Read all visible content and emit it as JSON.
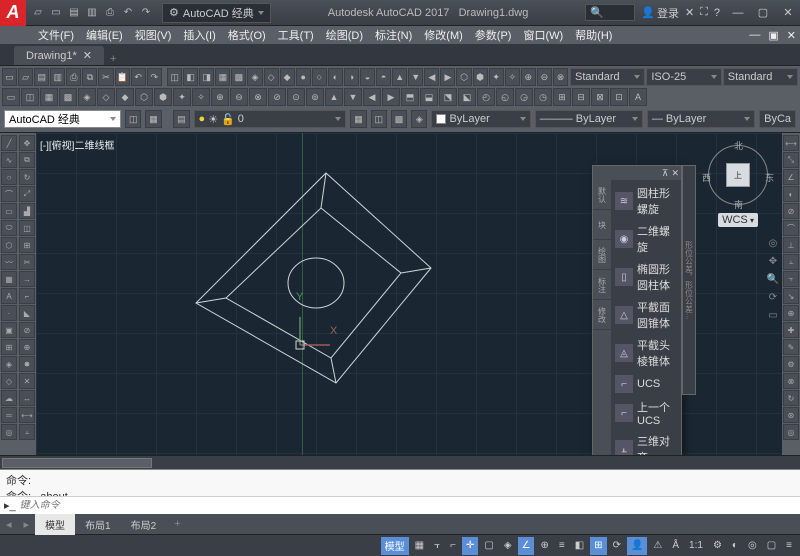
{
  "title": {
    "app": "Autodesk AutoCAD 2017",
    "doc": "Drawing1.dwg"
  },
  "login": "登录",
  "workspace_dd": "AutoCAD 经典",
  "menu": [
    "文件(F)",
    "编辑(E)",
    "视图(V)",
    "插入(I)",
    "格式(O)",
    "工具(T)",
    "绘图(D)",
    "标注(N)",
    "修改(M)",
    "参数(P)",
    "窗口(W)",
    "帮助(H)"
  ],
  "doctab": "Drawing1*",
  "prop": {
    "workspace": "AutoCAD 经典",
    "std1": "Standard",
    "iso": "ISO-25",
    "std2": "Standard",
    "layer": "0",
    "bylayer1": "ByLayer",
    "bylayer2": "ByLayer",
    "bylayer3": "ByLayer",
    "byca": "ByCa"
  },
  "view_label": "[-][俯视]二维线框",
  "compass": {
    "n": "北",
    "s": "南",
    "e": "东",
    "w": "西",
    "face": "上"
  },
  "wcs": "WCS",
  "axes": {
    "x": "X",
    "y": "Y"
  },
  "popup": {
    "tabs": [
      "默认",
      "块",
      "绘图",
      "标注",
      "修改"
    ],
    "items": [
      {
        "label": "圆柱形螺旋"
      },
      {
        "label": "二维螺旋"
      },
      {
        "label": "椭圆形圆柱体"
      },
      {
        "label": "平截面圆锥体"
      },
      {
        "label": "平截头棱锥体"
      },
      {
        "label": "UCS"
      },
      {
        "label": "上一个UCS"
      },
      {
        "label": "三维对齐"
      }
    ]
  },
  "side_label": "形位公差，形位公差...",
  "cmd": {
    "l1": "命令:",
    "l2": "命令: _about",
    "ph": "键入命令"
  },
  "tabs": {
    "model": "模型",
    "l1": "布局1",
    "l2": "布局2"
  },
  "status": {
    "model": "模型",
    "scale": "1:1"
  }
}
